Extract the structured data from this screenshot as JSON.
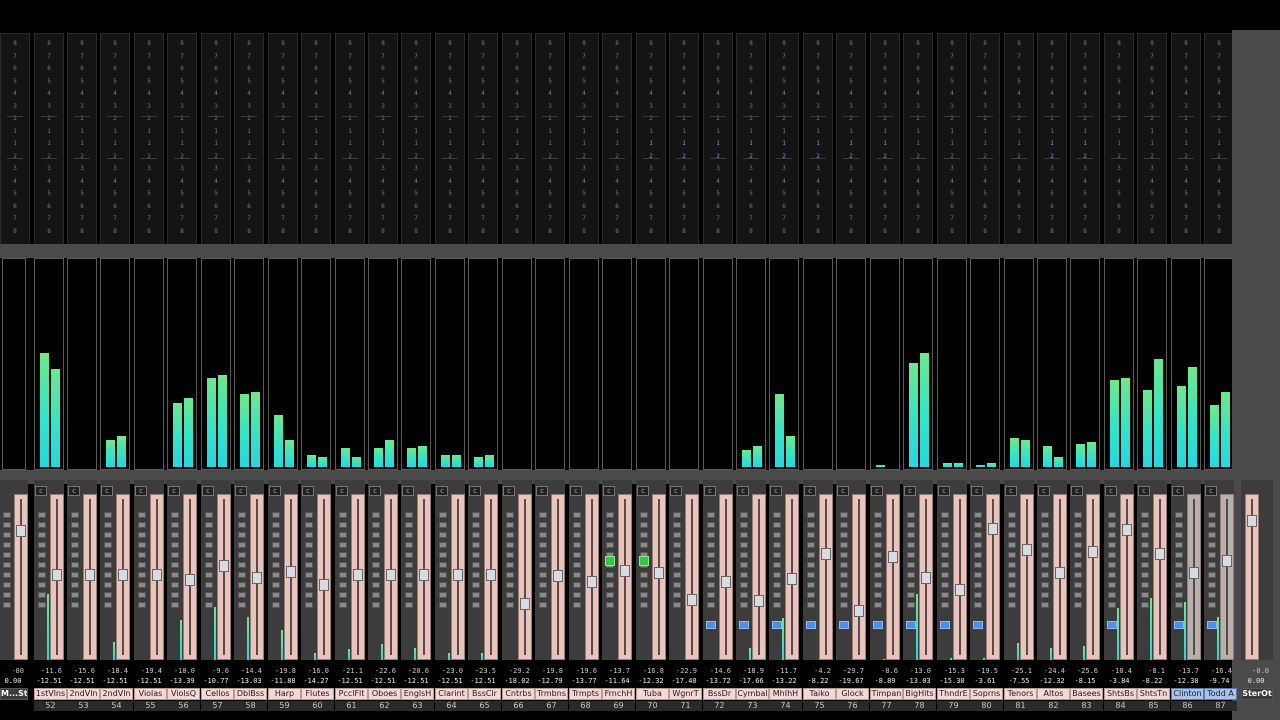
{
  "colors": {
    "meter_low": "#22d8e0",
    "meter_high": "#6ee88a",
    "fader_track": "#e8c4bc",
    "selected_name": "#a8c4ec",
    "send_active": "#6f9fe8",
    "button_blue": "#4b8fe8",
    "button_green": "#34c840"
  },
  "send_scale": [
    "8",
    "7",
    "6",
    "5",
    "4",
    "3",
    "2",
    "1",
    "1",
    "2",
    "3",
    "4",
    "5",
    "6",
    "7",
    "8"
  ],
  "master": {
    "name": "M...St",
    "value": "0.00",
    "peak": "-80",
    "meter_levels": [
      0,
      0
    ]
  },
  "channels": [
    {
      "name": "1stVlns",
      "num": "52",
      "value": "-12.51",
      "peak": "-11.6",
      "meter": [
        0.55,
        0.47
      ],
      "fader": 0.53
    },
    {
      "name": "2ndVln",
      "num": "53",
      "value": "-12.51",
      "peak": "-15.6",
      "meter": [
        0,
        0
      ],
      "fader": 0.53
    },
    {
      "name": "2ndVln",
      "num": "54",
      "value": "-12.51",
      "peak": "-18.4",
      "meter": [
        0.13,
        0.15
      ],
      "fader": 0.53
    },
    {
      "name": "Violas",
      "num": "55",
      "value": "-12.51",
      "peak": "-19.4",
      "meter": [
        0,
        0
      ],
      "fader": 0.53
    },
    {
      "name": "ViolsQ",
      "num": "56",
      "value": "-13.39",
      "peak": "-18.0",
      "meter": [
        0.31,
        0.33
      ],
      "fader": 0.49
    },
    {
      "name": "Cellos",
      "num": "57",
      "value": "-10.77",
      "peak": "-9.6",
      "meter": [
        0.43,
        0.44
      ],
      "fader": 0.59
    },
    {
      "name": "DblBss",
      "num": "58",
      "value": "-13.03",
      "peak": "-14.4",
      "meter": [
        0.35,
        0.36
      ],
      "fader": 0.51
    },
    {
      "name": "Harp",
      "num": "59",
      "value": "-11.88",
      "peak": "-19.8",
      "meter": [
        0.25,
        0.13
      ],
      "fader": 0.55
    },
    {
      "name": "Flutes",
      "num": "60",
      "value": "-14.27",
      "peak": "-16.0",
      "meter": [
        0.06,
        0.05
      ],
      "fader": 0.46
    },
    {
      "name": "PcclFlt",
      "num": "61",
      "value": "-12.51",
      "peak": "-21.1",
      "meter": [
        0.09,
        0.05
      ],
      "fader": 0.53
    },
    {
      "name": "Oboes",
      "num": "62",
      "value": "-12.51",
      "peak": "-22.6",
      "meter": [
        0.09,
        0.13
      ],
      "fader": 0.53
    },
    {
      "name": "EnglsH",
      "num": "63",
      "value": "-12.51",
      "peak": "-20.6",
      "meter": [
        0.09,
        0.1
      ],
      "fader": 0.53
    },
    {
      "name": "Clarint",
      "num": "64",
      "value": "-12.51",
      "peak": "-23.0",
      "meter": [
        0.06,
        0.06
      ],
      "fader": 0.53
    },
    {
      "name": "BssClr",
      "num": "65",
      "value": "-12.51",
      "peak": "-23.5",
      "meter": [
        0.05,
        0.06
      ],
      "fader": 0.53
    },
    {
      "name": "Cntrbs",
      "num": "66",
      "value": "-18.02",
      "peak": "-29.2",
      "meter": [
        0,
        0
      ],
      "fader": 0.32
    },
    {
      "name": "Trmbns",
      "num": "67",
      "value": "-12.79",
      "peak": "-19.8",
      "meter": [
        0,
        0
      ],
      "fader": 0.52
    },
    {
      "name": "Trmpts",
      "num": "68",
      "value": "-13.77",
      "peak": "-19.6",
      "meter": [
        0,
        0
      ],
      "fader": 0.48
    },
    {
      "name": "FrnchH",
      "num": "69",
      "value": "-11.64",
      "peak": "-13.7",
      "meter": [
        0,
        0
      ],
      "fader": 0.56
    },
    {
      "name": "Tuba",
      "num": "70",
      "value": "-12.32",
      "peak": "-16.8",
      "meter": [
        0,
        0
      ],
      "fader": 0.54
    },
    {
      "name": "WgnrT",
      "num": "71",
      "value": "-17.40",
      "peak": "-22.9",
      "meter": [
        0,
        0
      ],
      "fader": 0.35
    },
    {
      "name": "BssDr",
      "num": "72",
      "value": "-13.72",
      "peak": "-14.6",
      "meter": [
        0,
        0
      ],
      "fader": 0.48
    },
    {
      "name": "Cymbal",
      "num": "73",
      "value": "-17.66",
      "peak": "-18.9",
      "meter": [
        0.08,
        0.1
      ],
      "fader": 0.34
    },
    {
      "name": "MhIhH",
      "num": "74",
      "value": "-13.22",
      "peak": "-11.7",
      "meter": [
        0.35,
        0.15
      ],
      "fader": 0.5
    },
    {
      "name": "Taiko",
      "num": "75",
      "value": "-8.22",
      "peak": "-4.2",
      "meter": [
        0,
        0
      ],
      "fader": 0.68
    },
    {
      "name": "Glock",
      "num": "76",
      "value": "-19.67",
      "peak": "-29.7",
      "meter": [
        0,
        0
      ],
      "fader": 0.27
    },
    {
      "name": "Timpan",
      "num": "77",
      "value": "-8.89",
      "peak": "-8.6",
      "meter": [
        0.01,
        0
      ],
      "fader": 0.66
    },
    {
      "name": "BigHits",
      "num": "78",
      "value": "-13.03",
      "peak": "-13.0",
      "meter": [
        0.5,
        0.55
      ],
      "fader": 0.51
    },
    {
      "name": "ThndrE",
      "num": "79",
      "value": "-15.30",
      "peak": "-15.3",
      "meter": [
        0.02,
        0.02
      ],
      "fader": 0.42
    },
    {
      "name": "Soprns",
      "num": "80",
      "value": "-3.61",
      "peak": "-19.5",
      "meter": [
        0.01,
        0.02
      ],
      "fader": 0.86
    },
    {
      "name": "Tenors",
      "num": "81",
      "value": "-7.55",
      "peak": "-25.1",
      "meter": [
        0.14,
        0.13
      ],
      "fader": 0.71
    },
    {
      "name": "Altos",
      "num": "82",
      "value": "-12.32",
      "peak": "-24.4",
      "meter": [
        0.1,
        0.05
      ],
      "fader": 0.54
    },
    {
      "name": "Basees",
      "num": "83",
      "value": "-8.15",
      "peak": "-25.6",
      "meter": [
        0.11,
        0.12
      ],
      "fader": 0.69
    },
    {
      "name": "ShtsBs",
      "num": "84",
      "value": "-3.84",
      "peak": "-10.4",
      "meter": [
        0.42,
        0.43
      ],
      "fader": 0.85
    },
    {
      "name": "ShtsTn",
      "num": "85",
      "value": "-8.22",
      "peak": "-8.1",
      "meter": [
        0.37,
        0.52
      ],
      "fader": 0.68
    },
    {
      "name": "Clinton",
      "num": "86",
      "value": "-12.30",
      "peak": "-13.7",
      "meter": [
        0.39,
        0.48
      ],
      "fader": 0.54,
      "selected": true
    },
    {
      "name": "Todd A",
      "num": "87",
      "value": "-9.74",
      "peak": "-16.4",
      "meter": [
        0.3,
        0.36
      ],
      "fader": 0.63,
      "selected": true
    }
  ],
  "stereo_out": {
    "name": "SterOt",
    "value": "0.00",
    "peak": "-0.0",
    "meter_levels": [
      0.68,
      0.7
    ]
  },
  "blue_sends": [
    18,
    19,
    20,
    21,
    22,
    23,
    24,
    25,
    30,
    31
  ],
  "blue_buttons": [
    20,
    21,
    22,
    23,
    24,
    25,
    26,
    27,
    28,
    32,
    34,
    35
  ],
  "green_buttons": [
    17,
    18
  ]
}
